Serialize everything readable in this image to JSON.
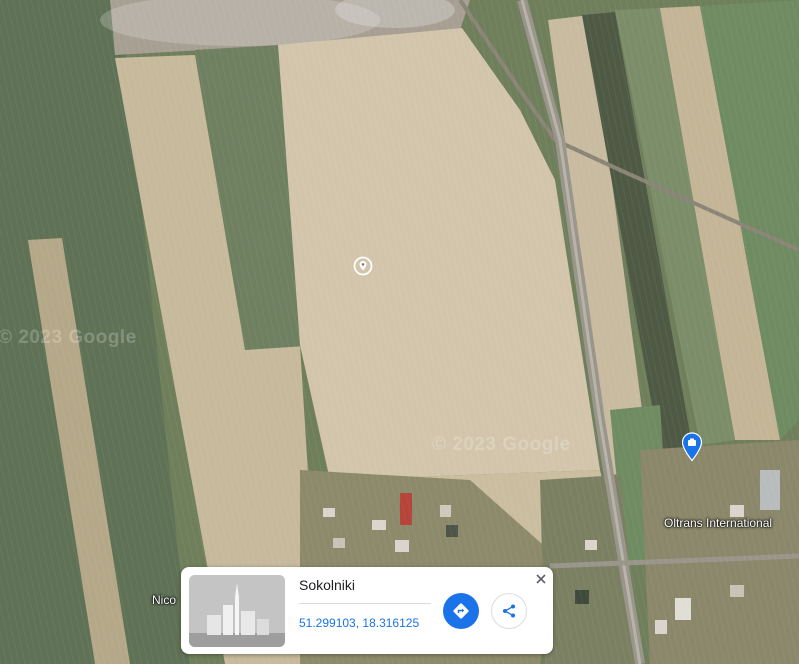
{
  "map": {
    "watermarks": [
      "© 2023 Google",
      "© 2023 Google"
    ],
    "labels": {
      "business": "Oltrans International",
      "partial_place": "Nico"
    },
    "pins": {
      "business_pin_color": "#1a73e8",
      "dropped_pin_icon": "location-marker-icon"
    }
  },
  "info_card": {
    "title": "Sokolniki",
    "coordinates": "51.299103, 18.316125",
    "buttons": {
      "directions_icon": "directions-icon",
      "share_icon": "share-icon",
      "close_icon": "close-icon"
    },
    "accent_color": "#1a73e8"
  }
}
